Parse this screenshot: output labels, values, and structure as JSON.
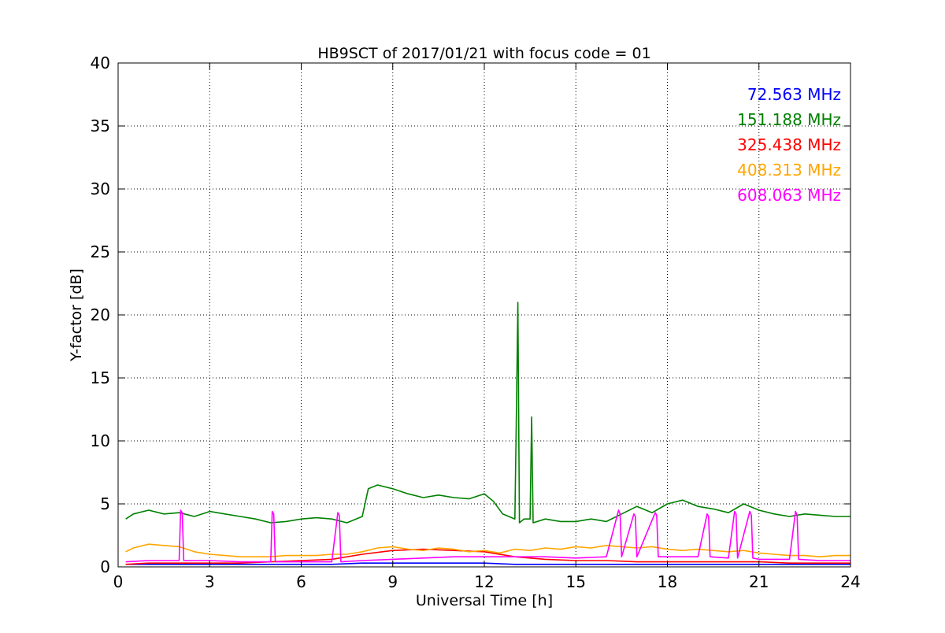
{
  "chart_data": {
    "type": "line",
    "title": "HB9SCT of 2017/01/21 with focus code = 01",
    "xlabel": "Universal Time [h]",
    "ylabel": "Y-factor [dB]",
    "xlim": [
      0,
      24
    ],
    "ylim": [
      0,
      40
    ],
    "xticks": [
      0,
      3,
      6,
      9,
      12,
      15,
      18,
      21,
      24
    ],
    "yticks": [
      0,
      5,
      10,
      15,
      20,
      25,
      30,
      35,
      40
    ],
    "grid": true,
    "legend_position": "top-right",
    "series": [
      {
        "name": "72.563 MHz",
        "color": "#0000ff",
        "x": [
          0.25,
          1,
          2,
          3,
          4,
          5,
          6,
          7,
          8,
          9,
          10,
          11,
          12,
          13,
          14,
          15,
          16,
          17,
          18,
          19,
          20,
          21,
          22,
          23,
          24
        ],
        "y": [
          0.2,
          0.2,
          0.2,
          0.2,
          0.2,
          0.2,
          0.2,
          0.2,
          0.3,
          0.3,
          0.3,
          0.3,
          0.3,
          0.2,
          0.2,
          0.2,
          0.2,
          0.2,
          0.2,
          0.2,
          0.2,
          0.2,
          0.2,
          0.2,
          0.2
        ]
      },
      {
        "name": "151.188 MHz",
        "color": "#008000",
        "x": [
          0.25,
          0.5,
          1,
          1.5,
          2,
          2.5,
          3,
          3.5,
          4,
          4.5,
          5,
          5.5,
          6,
          6.5,
          7,
          7.5,
          8,
          8.2,
          8.5,
          9,
          9.5,
          10,
          10.5,
          11,
          11.5,
          12,
          12.3,
          12.6,
          13,
          13.05,
          13.1,
          13.15,
          13.3,
          13.5,
          13.55,
          13.6,
          14,
          14.5,
          15,
          15.5,
          16,
          16.5,
          17,
          17.5,
          18,
          18.5,
          19,
          19.5,
          20,
          20.5,
          21,
          21.5,
          22,
          22.5,
          23,
          23.5,
          24
        ],
        "y": [
          3.8,
          4.2,
          4.5,
          4.2,
          4.3,
          4.0,
          4.4,
          4.2,
          4.0,
          3.8,
          3.5,
          3.6,
          3.8,
          3.9,
          3.8,
          3.5,
          4.0,
          6.2,
          6.5,
          6.2,
          5.8,
          5.5,
          5.7,
          5.5,
          5.4,
          5.8,
          5.2,
          4.2,
          3.8,
          12.0,
          21.0,
          3.5,
          3.8,
          3.8,
          11.9,
          3.5,
          3.8,
          3.6,
          3.6,
          3.8,
          3.6,
          4.2,
          4.8,
          4.3,
          5.0,
          5.3,
          4.8,
          4.6,
          4.3,
          5.0,
          4.5,
          4.2,
          4.0,
          4.2,
          4.1,
          4.0,
          4.0
        ]
      },
      {
        "name": "325.438 MHz",
        "color": "#ff0000",
        "x": [
          0.25,
          1,
          2,
          3,
          4,
          5,
          6,
          7,
          8,
          9,
          10,
          11,
          12,
          13,
          14,
          15,
          16,
          17,
          18,
          19,
          20,
          21,
          22,
          23,
          24
        ],
        "y": [
          0.2,
          0.3,
          0.3,
          0.3,
          0.3,
          0.4,
          0.5,
          0.6,
          1.0,
          1.3,
          1.4,
          1.3,
          1.2,
          0.8,
          0.6,
          0.5,
          0.5,
          0.4,
          0.4,
          0.4,
          0.4,
          0.4,
          0.3,
          0.3,
          0.3
        ]
      },
      {
        "name": "408.313 MHz",
        "color": "#ffa500",
        "x": [
          0.25,
          0.5,
          1,
          1.5,
          2,
          2.5,
          3,
          3.5,
          4,
          4.5,
          5,
          5.5,
          6,
          6.5,
          7,
          7.5,
          8,
          8.5,
          9,
          9.5,
          10,
          10.5,
          11,
          11.5,
          12,
          12.5,
          13,
          13.5,
          14,
          14.5,
          15,
          15.5,
          16,
          16.5,
          17,
          17.5,
          18,
          18.5,
          19,
          19.5,
          20,
          20.5,
          21,
          21.5,
          22,
          22.5,
          23,
          23.5,
          24
        ],
        "y": [
          1.2,
          1.5,
          1.8,
          1.7,
          1.6,
          1.2,
          1.0,
          0.9,
          0.8,
          0.8,
          0.8,
          0.9,
          0.9,
          0.9,
          1.0,
          1.0,
          1.2,
          1.5,
          1.6,
          1.4,
          1.3,
          1.5,
          1.4,
          1.2,
          1.3,
          1.1,
          1.4,
          1.3,
          1.5,
          1.4,
          1.6,
          1.5,
          1.7,
          1.6,
          1.5,
          1.6,
          1.4,
          1.3,
          1.4,
          1.3,
          1.2,
          1.3,
          1.1,
          1.0,
          0.9,
          0.9,
          0.8,
          0.9,
          0.9
        ]
      },
      {
        "name": "608.063 MHz",
        "color": "#ff00ff",
        "x": [
          0.25,
          1,
          2,
          2.05,
          2.1,
          2.15,
          3,
          4,
          5,
          5.05,
          5.1,
          5.15,
          6,
          7,
          7.2,
          7.25,
          7.3,
          8,
          9,
          10,
          11,
          12,
          13,
          14,
          15,
          16,
          16.4,
          16.45,
          16.5,
          16.9,
          16.95,
          17.0,
          17.6,
          17.65,
          17.7,
          18,
          19,
          19.3,
          19.35,
          19.4,
          20,
          20.2,
          20.25,
          20.3,
          20.7,
          20.75,
          20.8,
          21,
          22,
          22.2,
          22.25,
          22.3,
          23,
          24
        ],
        "y": [
          0.4,
          0.5,
          0.5,
          4.5,
          4.3,
          0.5,
          0.5,
          0.4,
          0.4,
          4.4,
          4.2,
          0.4,
          0.4,
          0.4,
          4.3,
          4.1,
          0.4,
          0.5,
          0.6,
          0.7,
          0.8,
          0.8,
          0.8,
          0.8,
          0.7,
          0.8,
          4.5,
          4.2,
          0.8,
          4.2,
          4.0,
          0.8,
          4.3,
          4.1,
          0.8,
          0.8,
          0.8,
          4.2,
          4.0,
          0.8,
          0.7,
          4.4,
          4.2,
          0.7,
          4.4,
          4.1,
          0.7,
          0.6,
          0.6,
          4.4,
          4.1,
          0.6,
          0.5,
          0.5
        ]
      }
    ]
  }
}
